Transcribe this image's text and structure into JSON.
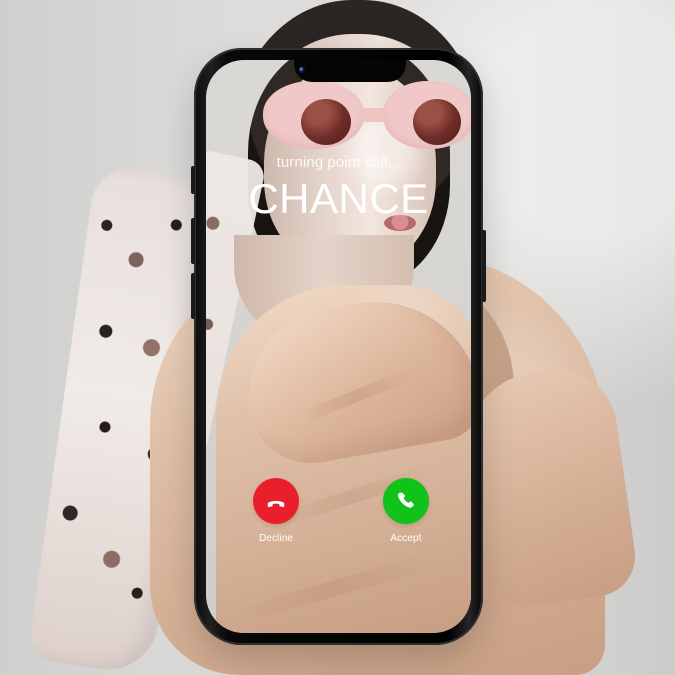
{
  "call_screen": {
    "subtitle": "turning point call...",
    "caller_name": "CHANCE",
    "actions": {
      "decline": {
        "label": "Decline",
        "color": "#eb1f2c",
        "icon": "phone-hangup-icon"
      },
      "accept": {
        "label": "Accept",
        "color": "#10c21a",
        "icon": "phone-icon"
      }
    }
  }
}
